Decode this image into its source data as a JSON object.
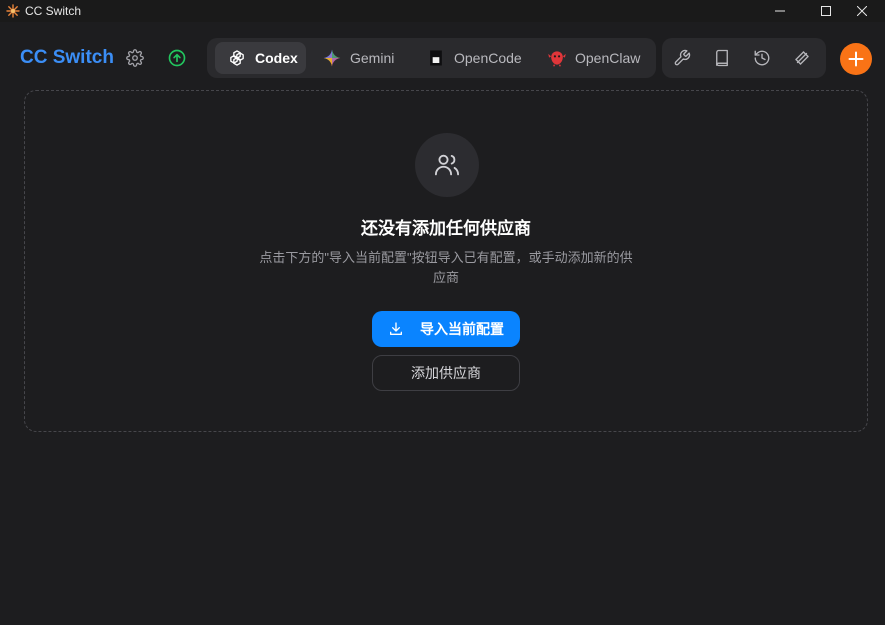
{
  "window": {
    "title": "CC Switch",
    "controls": [
      "minimize-icon",
      "maximize-icon",
      "close-icon"
    ]
  },
  "header": {
    "brand": "CC Switch",
    "brand_color": "#3b8ef6",
    "icons": [
      "gear-icon",
      "upload-circle-icon"
    ],
    "status_color": "#22c55e"
  },
  "app_tabs": [
    {
      "label": "Codex",
      "icon": "openai-icon",
      "active": true
    },
    {
      "label": "Gemini",
      "icon": "gemini-sparkle-icon",
      "active": false
    },
    {
      "label": "OpenCode",
      "icon": "opencode-icon",
      "active": false
    },
    {
      "label": "OpenClaw",
      "icon": "openclaw-icon",
      "active": false
    }
  ],
  "tools": [
    "wrench-icon",
    "book-icon",
    "history-icon",
    "layers-icon"
  ],
  "add_button": {
    "icon": "plus-icon",
    "color": "#f97316"
  },
  "empty_state": {
    "icon": "users-icon",
    "title": "还没有添加任何供应商",
    "description": "点击下方的\"导入当前配置\"按钮导入已有配置，或手动添加新的供应商",
    "import_label": "导入当前配置",
    "import_icon": "download-icon",
    "add_label": "添加供应商",
    "accent": "#0a84ff"
  }
}
